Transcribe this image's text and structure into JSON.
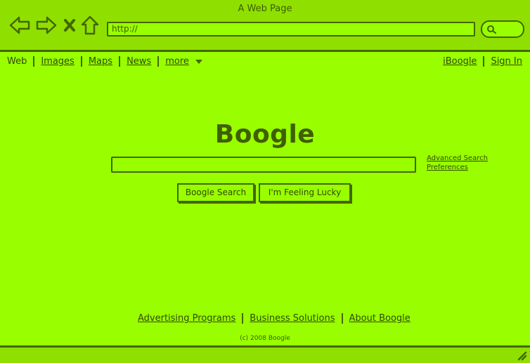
{
  "window": {
    "title": "A Web Page"
  },
  "browser": {
    "back_icon": "back-arrow-icon",
    "forward_icon": "forward-arrow-icon",
    "stop_icon": "close-icon",
    "home_icon": "home-icon",
    "url": "http://",
    "search_icon": "search-icon"
  },
  "nav": {
    "items": [
      {
        "label": "Web"
      },
      {
        "label": "Images"
      },
      {
        "label": "Maps"
      },
      {
        "label": "News"
      },
      {
        "label": "more"
      }
    ],
    "right": [
      {
        "label": "iBoogle"
      },
      {
        "label": "Sign In"
      }
    ]
  },
  "main": {
    "logo": "Boogle",
    "search_value": "",
    "advanced": "Advanced Search",
    "preferences": "Preferences",
    "buttons": [
      {
        "label": "Boogle Search"
      },
      {
        "label": "I'm Feeling Lucky"
      }
    ]
  },
  "footer": {
    "links": [
      {
        "label": "Advertising Programs"
      },
      {
        "label": "Business Solutions"
      },
      {
        "label": "About Boogle"
      }
    ],
    "copyright": "(c) 2008 Boogle"
  },
  "colors": {
    "background": "#99ff00",
    "ink": "#446600"
  }
}
